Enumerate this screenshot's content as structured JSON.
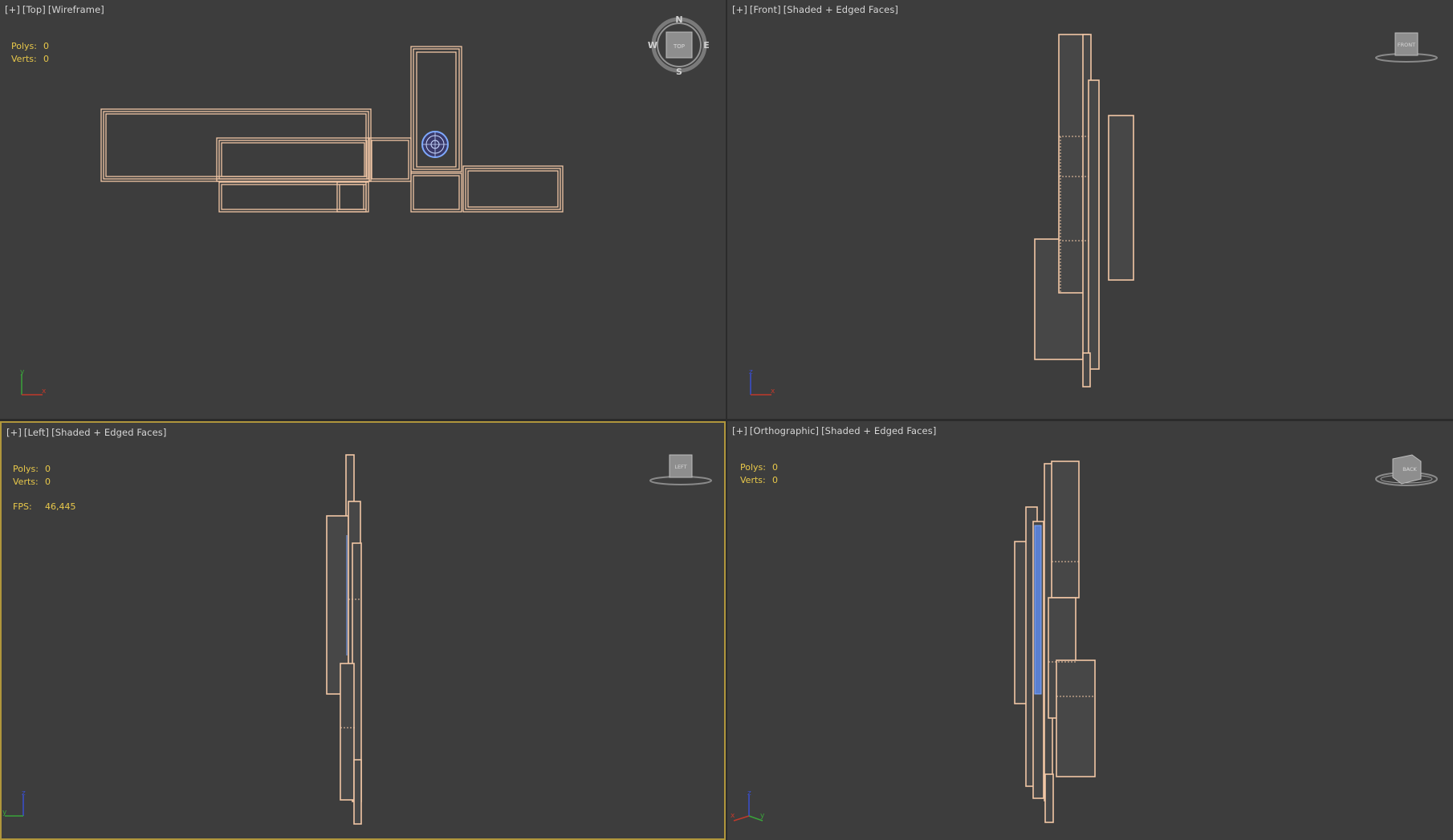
{
  "viewports": {
    "top": {
      "labels": [
        "[+]",
        "[Top]",
        "[Wireframe]"
      ],
      "stats": {
        "polys_label": "Polys:",
        "polys": "0",
        "verts_label": "Verts:",
        "verts": "0"
      },
      "compass": {
        "n": "N",
        "s": "S",
        "e": "E",
        "w": "W",
        "cube": "TOP"
      }
    },
    "front": {
      "labels": [
        "[+]",
        "[Front]",
        "[Shaded + Edged Faces]"
      ],
      "cube": "FRONT"
    },
    "left": {
      "labels": [
        "[+]",
        "[Left]",
        "[Shaded + Edged Faces]"
      ],
      "stats": {
        "polys_label": "Polys:",
        "polys": "0",
        "verts_label": "Verts:",
        "verts": "0",
        "fps_label": "FPS:",
        "fps": "46,445"
      },
      "cube": "LEFT"
    },
    "ortho": {
      "labels": [
        "[+]",
        "[Orthographic]",
        "[Shaded + Edged Faces]"
      ],
      "stats": {
        "polys_label": "Polys:",
        "polys": "0",
        "verts_label": "Verts:",
        "verts": "0"
      },
      "cube": "BACK"
    }
  },
  "axes": {
    "x": "x",
    "y": "y",
    "z": "z"
  },
  "colors": {
    "viewport_bg": "#3d3d3d",
    "divider": "#2b2b2b",
    "wire": "#f2c7a6",
    "active_border": "#b0963c",
    "stats": "#e8c84a",
    "label": "#d6d6d6",
    "axis_x": "#c0392b",
    "axis_y": "#3aa33a",
    "axis_z": "#3a4fd0",
    "selection": "#7fa9ff"
  }
}
